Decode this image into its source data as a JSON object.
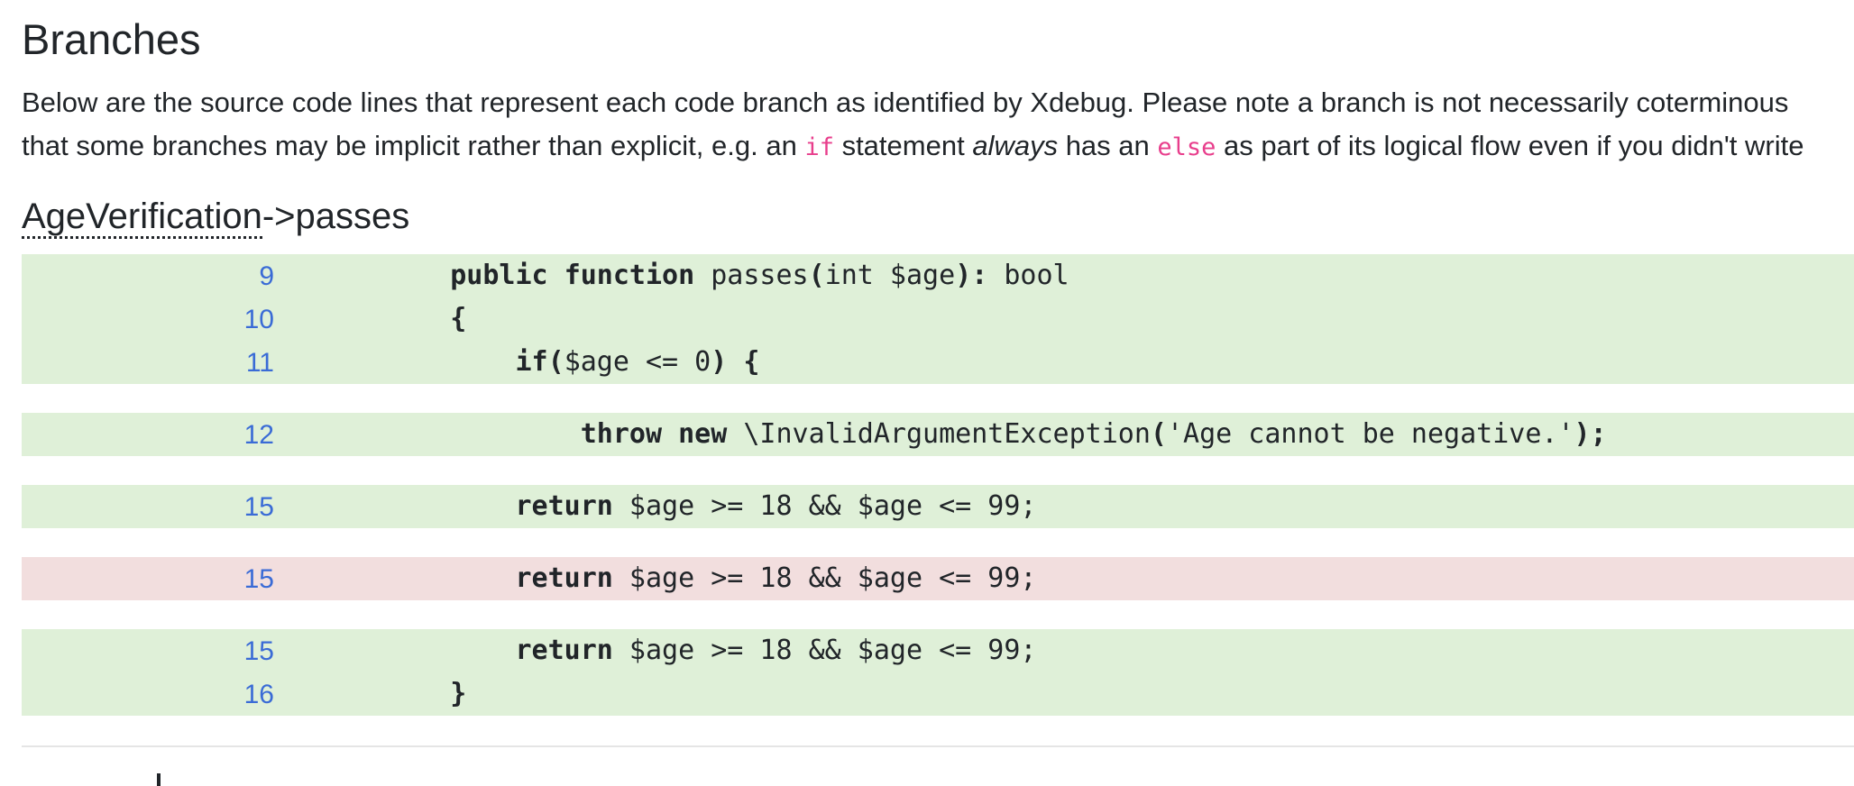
{
  "page": {
    "title": "Branches",
    "intro": {
      "line1": "Below are the source code lines that represent each code branch as identified by Xdebug. Please note a branch is not necessarily coterminous",
      "line2_part1": "that some branches may be implicit rather than explicit, e.g. an ",
      "line2_code1": "if",
      "line2_part2": " statement ",
      "line2_em": "always",
      "line2_part3": " has an ",
      "line2_code2": "else",
      "line2_part4": " as part of its logical flow even if you didn't write"
    }
  },
  "method": {
    "class_name": "AgeVerification",
    "separator_and_method": "->passes"
  },
  "branches": [
    {
      "covered": true,
      "lines": [
        {
          "number": "9",
          "tokens": [
            {
              "t": "    ",
              "b": false
            },
            {
              "t": "public",
              "b": true
            },
            {
              "t": " ",
              "b": false
            },
            {
              "t": "function",
              "b": true
            },
            {
              "t": " passes",
              "b": false
            },
            {
              "t": "(",
              "b": true
            },
            {
              "t": "int $age",
              "b": false
            },
            {
              "t": "):",
              "b": true
            },
            {
              "t": " bool",
              "b": false
            }
          ]
        },
        {
          "number": "10",
          "tokens": [
            {
              "t": "    ",
              "b": false
            },
            {
              "t": "{",
              "b": true
            }
          ]
        },
        {
          "number": "11",
          "tokens": [
            {
              "t": "        ",
              "b": false
            },
            {
              "t": "if(",
              "b": true
            },
            {
              "t": "$age <= 0",
              "b": false
            },
            {
              "t": ") {",
              "b": true
            }
          ]
        }
      ]
    },
    {
      "covered": true,
      "lines": [
        {
          "number": "12",
          "tokens": [
            {
              "t": "            ",
              "b": false
            },
            {
              "t": "throw",
              "b": true
            },
            {
              "t": " ",
              "b": false
            },
            {
              "t": "new",
              "b": true
            },
            {
              "t": " \\InvalidArgumentException",
              "b": false
            },
            {
              "t": "(",
              "b": true
            },
            {
              "t": "'Age cannot be negative.'",
              "b": false
            },
            {
              "t": ");",
              "b": true
            }
          ]
        }
      ]
    },
    {
      "covered": true,
      "lines": [
        {
          "number": "15",
          "tokens": [
            {
              "t": "        ",
              "b": false
            },
            {
              "t": "return",
              "b": true
            },
            {
              "t": " $age >= 18 && $age <= 99;",
              "b": false
            }
          ]
        }
      ]
    },
    {
      "covered": false,
      "lines": [
        {
          "number": "15",
          "tokens": [
            {
              "t": "        ",
              "b": false
            },
            {
              "t": "return",
              "b": true
            },
            {
              "t": " $age >= 18 && $age <= 99;",
              "b": false
            }
          ]
        }
      ]
    },
    {
      "covered": true,
      "lines": [
        {
          "number": "15",
          "tokens": [
            {
              "t": "        ",
              "b": false
            },
            {
              "t": "return",
              "b": true
            },
            {
              "t": " $age >= 18 && $age <= 99;",
              "b": false
            }
          ]
        },
        {
          "number": "16",
          "tokens": [
            {
              "t": "    ",
              "b": false
            },
            {
              "t": "}",
              "b": true
            }
          ]
        }
      ]
    }
  ],
  "colors": {
    "covered": "#dff0d8",
    "uncovered": "#f2dede",
    "line_number": "#3a6bd6",
    "inline_code": "#e83e8c"
  }
}
